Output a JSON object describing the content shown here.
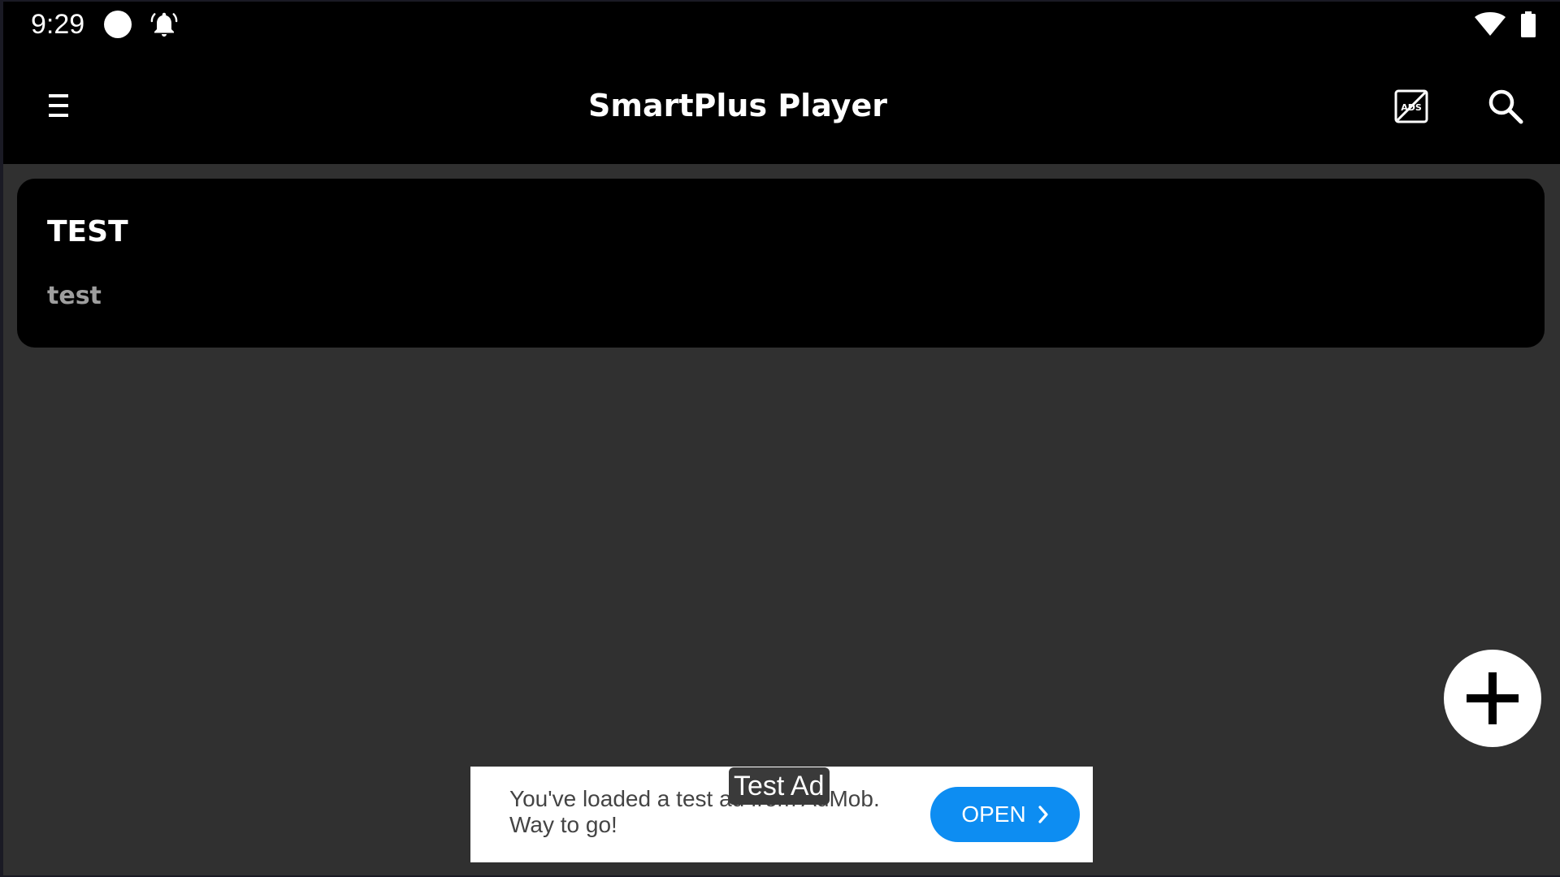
{
  "status_bar": {
    "time": "9:29",
    "icons": [
      "circle-icon",
      "alarm-bell-icon",
      "wifi-icon",
      "battery-icon"
    ]
  },
  "app_bar": {
    "title": "SmartPlus Player",
    "menu_icon": "hamburger-menu-icon",
    "ads_icon": "ads-off-icon",
    "ads_icon_text": "ADS",
    "search_icon": "search-icon"
  },
  "playlist": {
    "items": [
      {
        "title": "TEST",
        "subtitle": "test"
      }
    ]
  },
  "fab": {
    "icon": "plus-icon"
  },
  "ad": {
    "text": "You've loaded a test ad from AdMob. Way to go!",
    "label": "Test Ad",
    "button_label": "OPEN",
    "button_icon": "chevron-right-icon"
  },
  "colors": {
    "background": "#303030",
    "bar": "#000000",
    "card": "#000000",
    "subtitle": "#9e9e9e",
    "ad_button": "#0d8df2"
  }
}
